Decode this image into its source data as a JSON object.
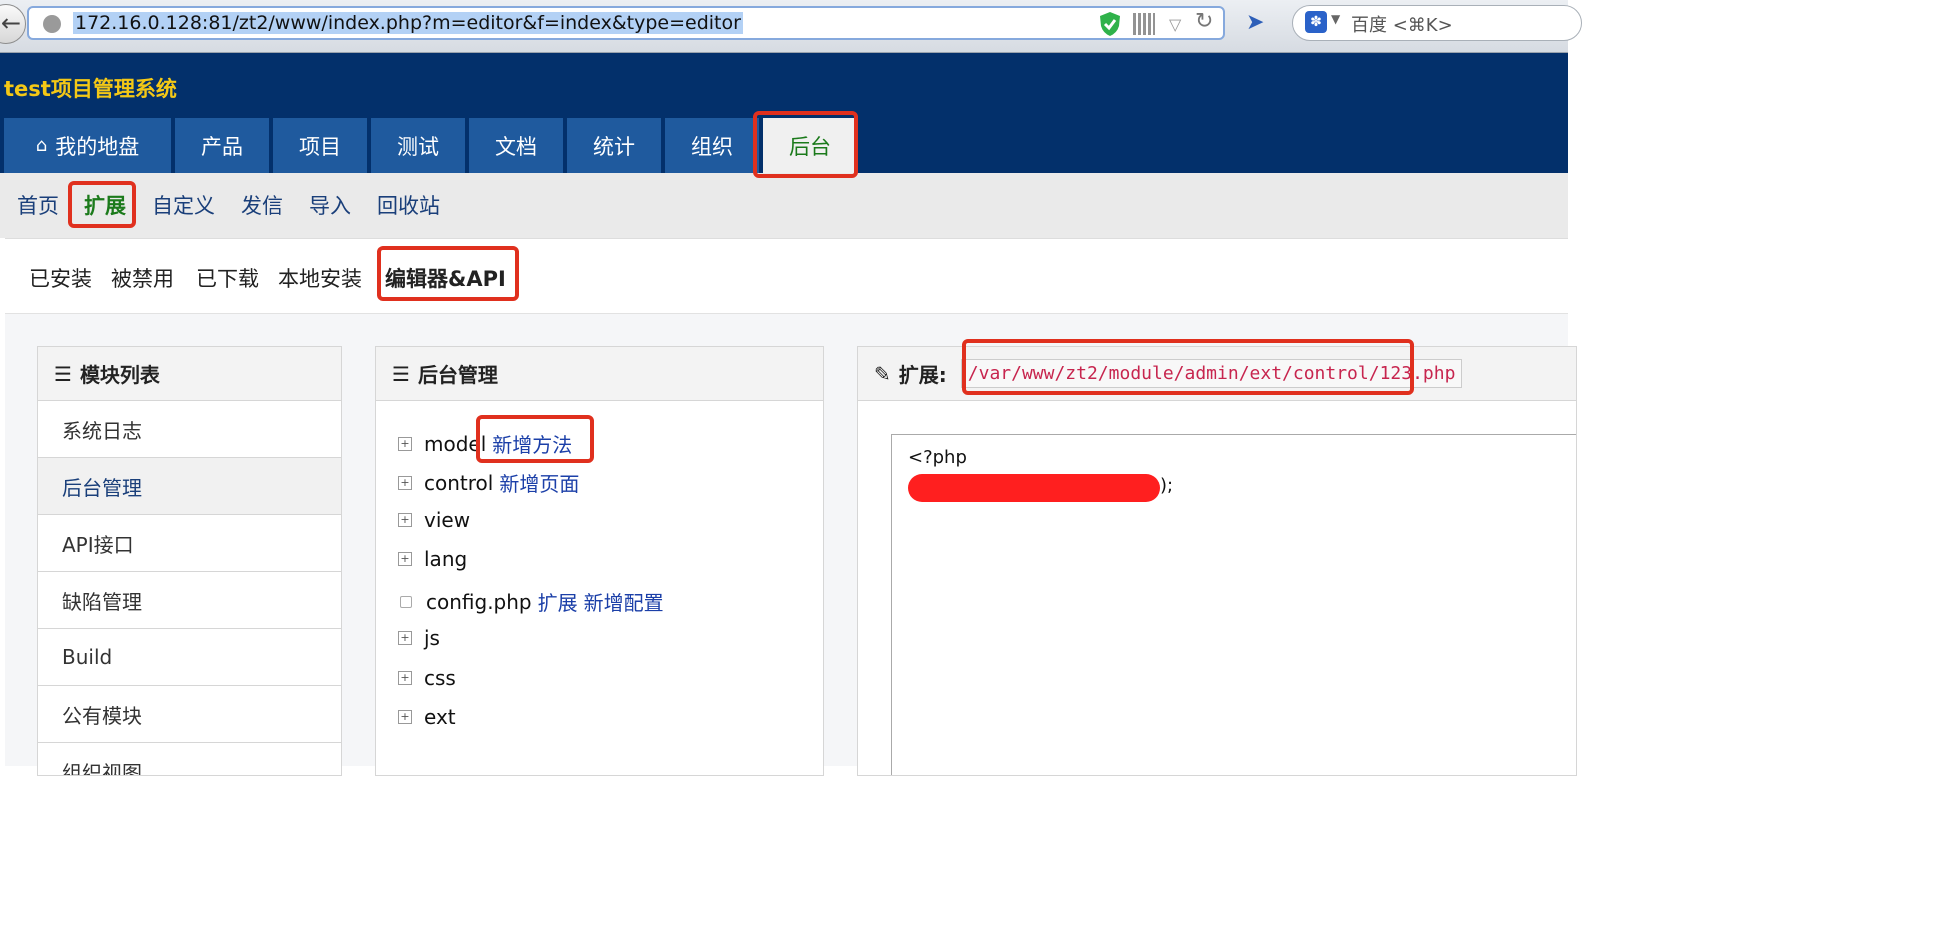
{
  "browser": {
    "url": "172.16.0.128:81/zt2/www/index.php?m=editor&f=index&type=editor",
    "search_placeholder": "百度 <⌘K>",
    "icons": [
      "back-icon",
      "globe-icon",
      "shield-icon",
      "qr-code-icon",
      "dropdown-icon",
      "reload-icon",
      "extension-icon",
      "baidu-paw-icon"
    ]
  },
  "app": {
    "title": "test项目管理系统",
    "main_nav": [
      "我的地盘",
      "产品",
      "项目",
      "测试",
      "文档",
      "统计",
      "组织",
      "后台"
    ],
    "active_main_nav": "后台"
  },
  "sub_nav": {
    "items": [
      "首页",
      "扩展",
      "自定义",
      "发信",
      "导入",
      "回收站"
    ],
    "active": "扩展"
  },
  "tabs": {
    "items": [
      "已安装",
      "被禁用",
      "已下载",
      "本地安装",
      "编辑器&API"
    ],
    "active": "编辑器&API"
  },
  "module_panel": {
    "title": "模块列表",
    "items": [
      "系统日志",
      "后台管理",
      "API接口",
      "缺陷管理",
      "Build",
      "公有模块",
      "组织视图"
    ],
    "active": "后台管理"
  },
  "tree_panel": {
    "title": "后台管理",
    "rows": [
      {
        "name": "model",
        "links": [
          "新增方法"
        ]
      },
      {
        "name": "control",
        "links": [
          "新增页面"
        ]
      },
      {
        "name": "view",
        "links": []
      },
      {
        "name": "lang",
        "links": []
      },
      {
        "name": "config.php",
        "links": [
          "扩展",
          "新增配置"
        ]
      },
      {
        "name": "js",
        "links": []
      },
      {
        "name": "css",
        "links": []
      },
      {
        "name": "ext",
        "links": []
      }
    ]
  },
  "editor_panel": {
    "label": "扩展:",
    "path": "/var/www/zt2/module/admin/ext/control/123.php",
    "code_line1": "<?php",
    "code_line2_suffix": ");"
  },
  "colors": {
    "header_bg": "#03306b",
    "title_yellow": "#f4c816",
    "nav_tab": "#1f5a9e",
    "active_green": "#1b7a1b",
    "highlight_red": "#e0301e"
  }
}
